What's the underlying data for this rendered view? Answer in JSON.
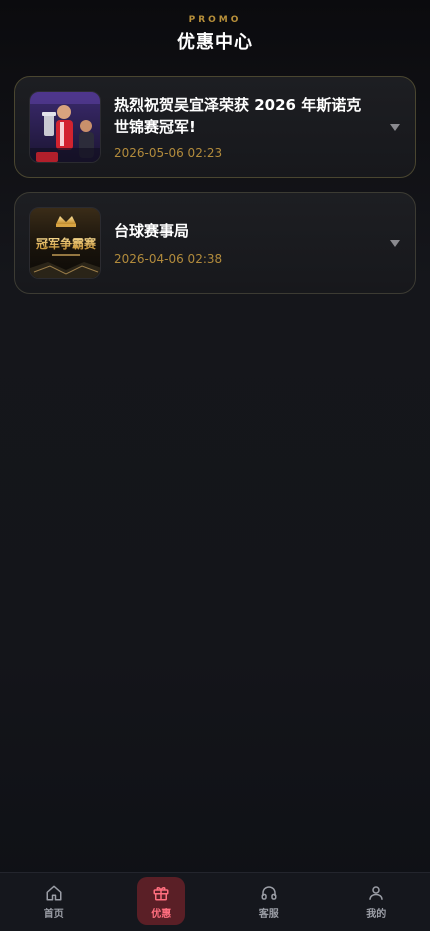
{
  "header": {
    "eyebrow": "PROMO",
    "title": "优惠中心"
  },
  "promos": [
    {
      "title": "热烈祝贺吴宜泽荣获 2026 年斯诺克世锦赛冠军!",
      "date": "2026-05-06 02:23",
      "thumb_icon": "trophy-photo"
    },
    {
      "title": "台球赛事局",
      "date": "2026-04-06 02:38",
      "thumb_text": "冠军争霸赛",
      "thumb_icon": "crown-banner"
    }
  ],
  "tabs": [
    {
      "label": "首页",
      "icon": "home-icon",
      "active": false
    },
    {
      "label": "优惠",
      "icon": "gift-icon",
      "active": true
    },
    {
      "label": "客服",
      "icon": "headset-icon",
      "active": false
    },
    {
      "label": "我的",
      "icon": "user-icon",
      "active": false
    }
  ],
  "colors": {
    "accent": "#b28b3c",
    "active_tab": "#ff6f7f",
    "active_tab_bg": "#5a1f26"
  }
}
